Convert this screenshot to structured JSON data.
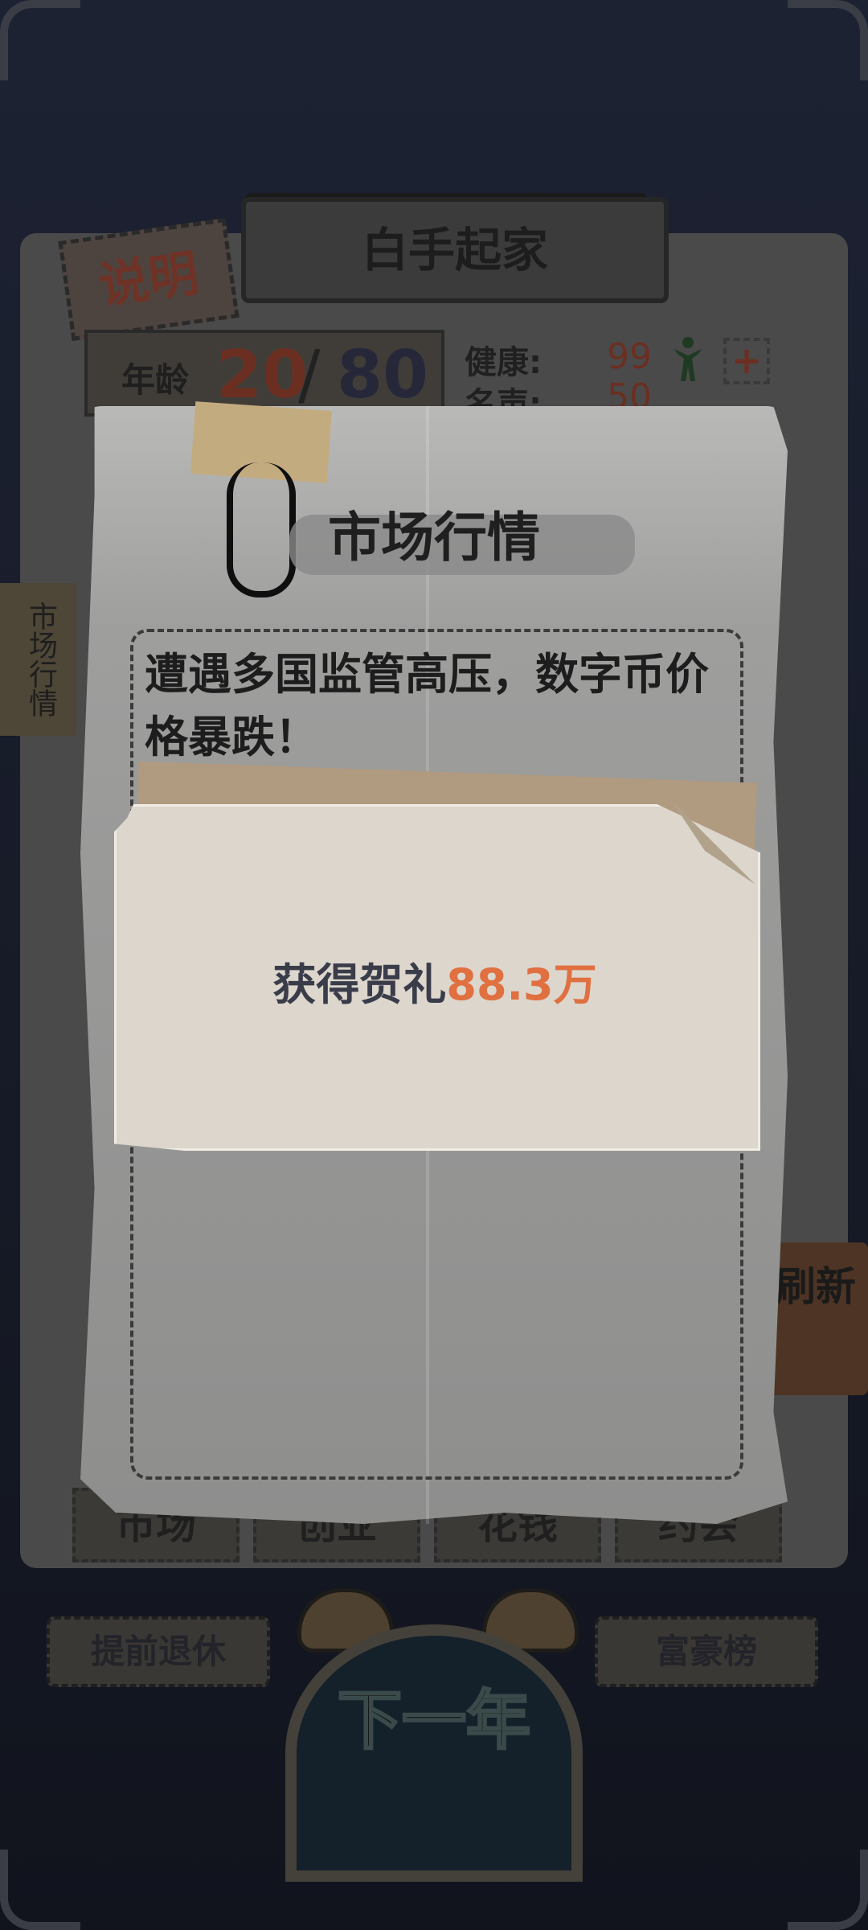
{
  "header": {
    "title": "白手起家",
    "explain_label": "说明"
  },
  "stats": {
    "age_label": "年龄",
    "age_value": "20",
    "age_separator": "/",
    "age_max": "80",
    "health_label": "健康:",
    "health_value": "99",
    "fame_label": "名声:",
    "fame_value": "50",
    "plus_label": "+"
  },
  "side_tab_label": "市场行情",
  "refresh_label": "刷新",
  "bottom_tabs": [
    "市场",
    "创业",
    "花钱",
    "约会"
  ],
  "buttons": {
    "retire": "提前退休",
    "rich_list": "富豪榜",
    "next_year": "下一年"
  },
  "modal": {
    "title": "市场行情",
    "event_text": "遭遇多国监管高压，数字币价格暴跌！",
    "reward_label": "获得贺礼",
    "reward_amount": "88.3万"
  },
  "colors": {
    "accent_orange": "#e07040",
    "reward_label": "#3a3c4a"
  }
}
